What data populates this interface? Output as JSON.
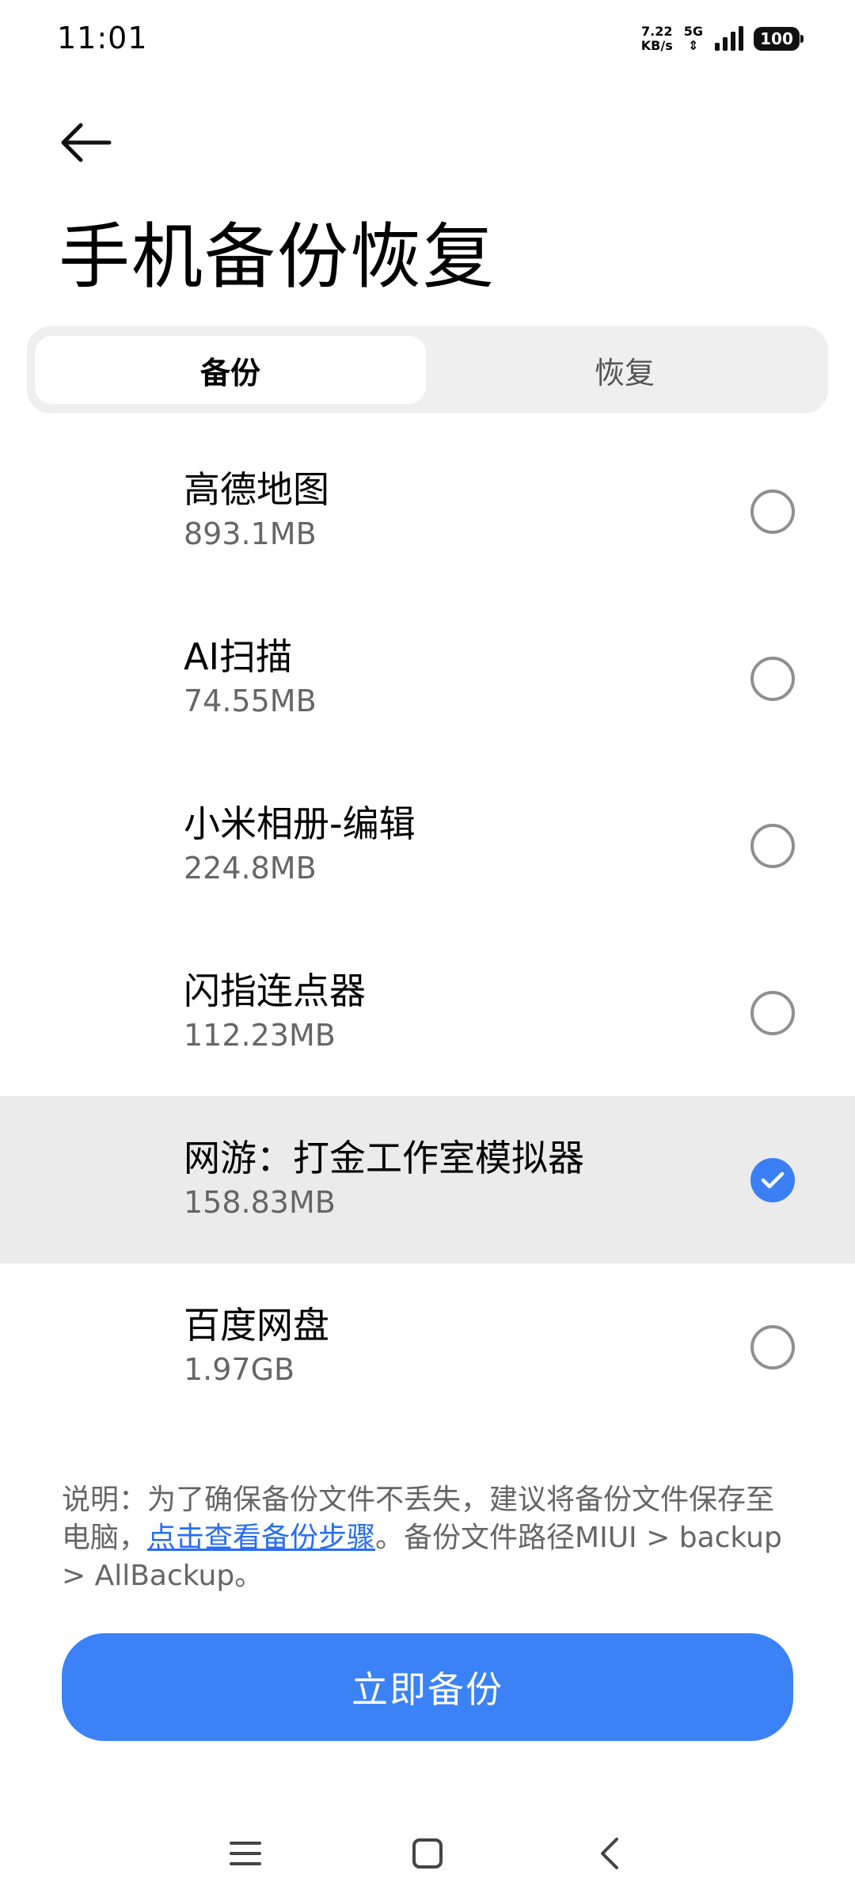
{
  "status_bar": {
    "time": "11:01",
    "net_speed_value": "7.22",
    "net_speed_unit": "KB/s",
    "network_type": "5G",
    "network_arrows": "⇕",
    "battery": "100"
  },
  "header": {
    "title": "手机备份恢复"
  },
  "tabs": [
    {
      "label": "备份",
      "active": true
    },
    {
      "label": "恢复",
      "active": false
    }
  ],
  "apps": [
    {
      "name": "高德地图",
      "size": "893.1MB",
      "selected": false
    },
    {
      "name": "AI扫描",
      "size": "74.55MB",
      "selected": false
    },
    {
      "name": "小米相册-编辑",
      "size": "224.8MB",
      "selected": false
    },
    {
      "name": "闪指连点器",
      "size": "112.23MB",
      "selected": false
    },
    {
      "name": "网游：打金工作室模拟器",
      "size": "158.83MB",
      "selected": true
    },
    {
      "name": "百度网盘",
      "size": "1.97GB",
      "selected": false
    }
  ],
  "note": {
    "prefix": "说明：为了确保备份文件不丢失，建议将备份文件保存至电脑，",
    "link": "点击查看备份步骤",
    "suffix": "。备份文件路径MIUI > backup > AllBackup。"
  },
  "primary_button": {
    "label": "立即备份"
  },
  "colors": {
    "accent": "#3b82f6",
    "link": "#2a6ef0",
    "selected_row_bg": "#ebebeb",
    "tab_track_bg": "#efefef"
  },
  "icons": {
    "back": "arrow-left-icon",
    "radio_checked": "checkmark-icon",
    "nav_menu": "menu-icon",
    "nav_home": "home-square-icon",
    "nav_back": "chevron-left-icon"
  }
}
